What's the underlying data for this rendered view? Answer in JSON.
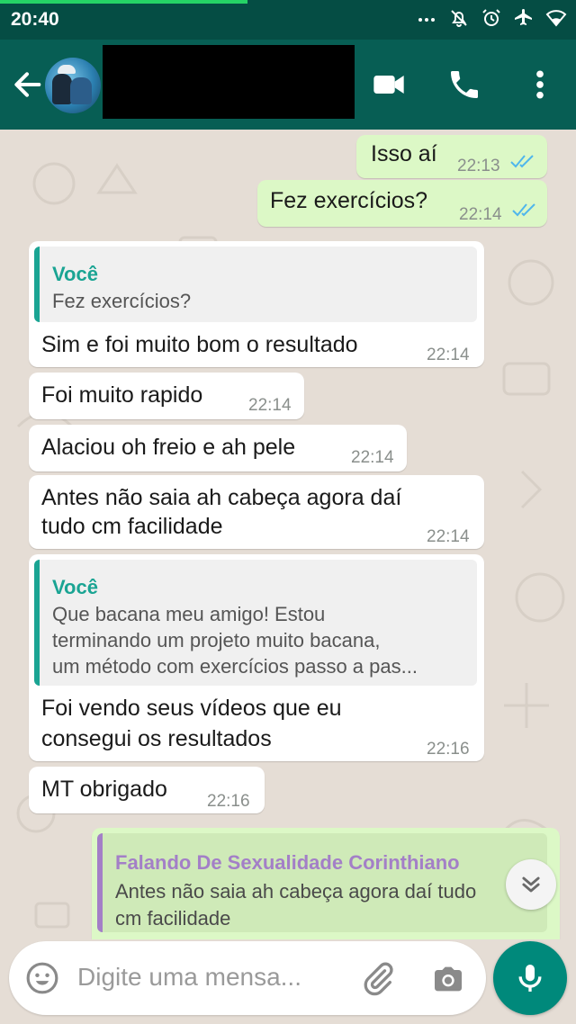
{
  "status_bar": {
    "time": "20:40",
    "icons": [
      "more-dots-icon",
      "mute-icon",
      "alarm-icon",
      "airplane-icon",
      "wifi-icon"
    ],
    "progress": 0.43
  },
  "header": {
    "contact_name": "",
    "icons": [
      "back-arrow-icon",
      "video-call-icon",
      "voice-call-icon",
      "overflow-menu-icon"
    ]
  },
  "messages": [
    {
      "dir": "out",
      "text": "Isso aí",
      "time": "22:13",
      "read": true
    },
    {
      "dir": "out",
      "text": "Fez exercícios?",
      "time": "22:14",
      "read": true
    },
    {
      "dir": "in",
      "quote": {
        "name": "Você",
        "lines": [
          "Fez exercícios?"
        ]
      },
      "lines": [
        "Sim e foi muito bom o resultado"
      ],
      "time": "22:14"
    },
    {
      "dir": "in",
      "lines": [
        "Foi muito rapido"
      ],
      "time": "22:14"
    },
    {
      "dir": "in",
      "lines": [
        "Alaciou oh freio e ah pele"
      ],
      "time": "22:14"
    },
    {
      "dir": "in",
      "lines": [
        "Antes não saia ah cabeça agora daí",
        "tudo cm facilidade"
      ],
      "time": "22:14"
    },
    {
      "dir": "in",
      "quote": {
        "name": "Você",
        "lines": [
          "Que bacana meu amigo! Estou",
          "terminando um projeto muito bacana,",
          "um método com exercícios passo a pas..."
        ]
      },
      "lines": [
        "Foi vendo seus vídeos que eu",
        "consegui os resultados"
      ],
      "time": "22:16"
    },
    {
      "dir": "in",
      "lines": [
        "MT obrigado"
      ],
      "time": "22:16"
    },
    {
      "dir": "out",
      "quote": {
        "name": "Falando De Sexualidade Corinthiano",
        "lines": [
          "Antes não saia ah cabeça agora daí tudo",
          "cm facilidade"
        ]
      }
    }
  ],
  "composer": {
    "placeholder": "Digite uma mensa...",
    "icons": [
      "emoji-icon",
      "attach-icon",
      "camera-icon",
      "mic-icon"
    ]
  },
  "colors": {
    "status_bar": "#054d44",
    "app_bar": "#075e54",
    "chat_bg": "#e5ddd5",
    "outgoing_bubble": "#dcf8c6",
    "incoming_bubble": "#ffffff",
    "quote_accent_self": "#1aa493",
    "quote_accent_other": "#a37fc7",
    "read_ticks": "#4fb6ec",
    "mic_button": "#00897b"
  }
}
